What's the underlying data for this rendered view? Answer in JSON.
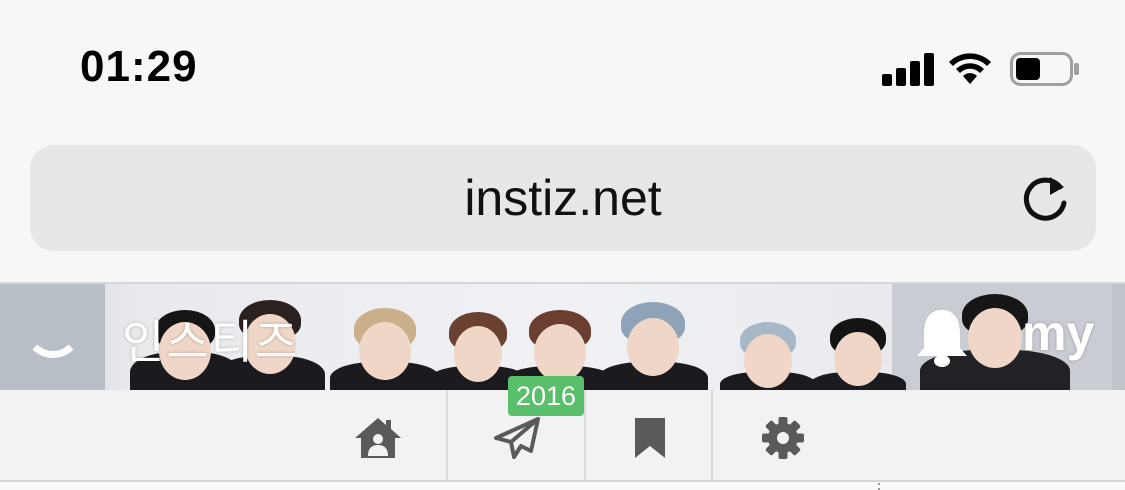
{
  "status_bar": {
    "time": "01:29"
  },
  "browser": {
    "url": "instiz.net"
  },
  "banner": {
    "logo_text": "인스티즈",
    "my_label": "my"
  },
  "nav": {
    "items": [
      {
        "icon": "home-icon"
      },
      {
        "icon": "paper-plane-icon",
        "badge": "2016"
      },
      {
        "icon": "bookmark-icon"
      },
      {
        "icon": "gear-icon"
      }
    ]
  },
  "colors": {
    "badge": "#5abf6b",
    "nav_icon": "#5a5a5a",
    "url_bar": "#e7e7ea"
  }
}
